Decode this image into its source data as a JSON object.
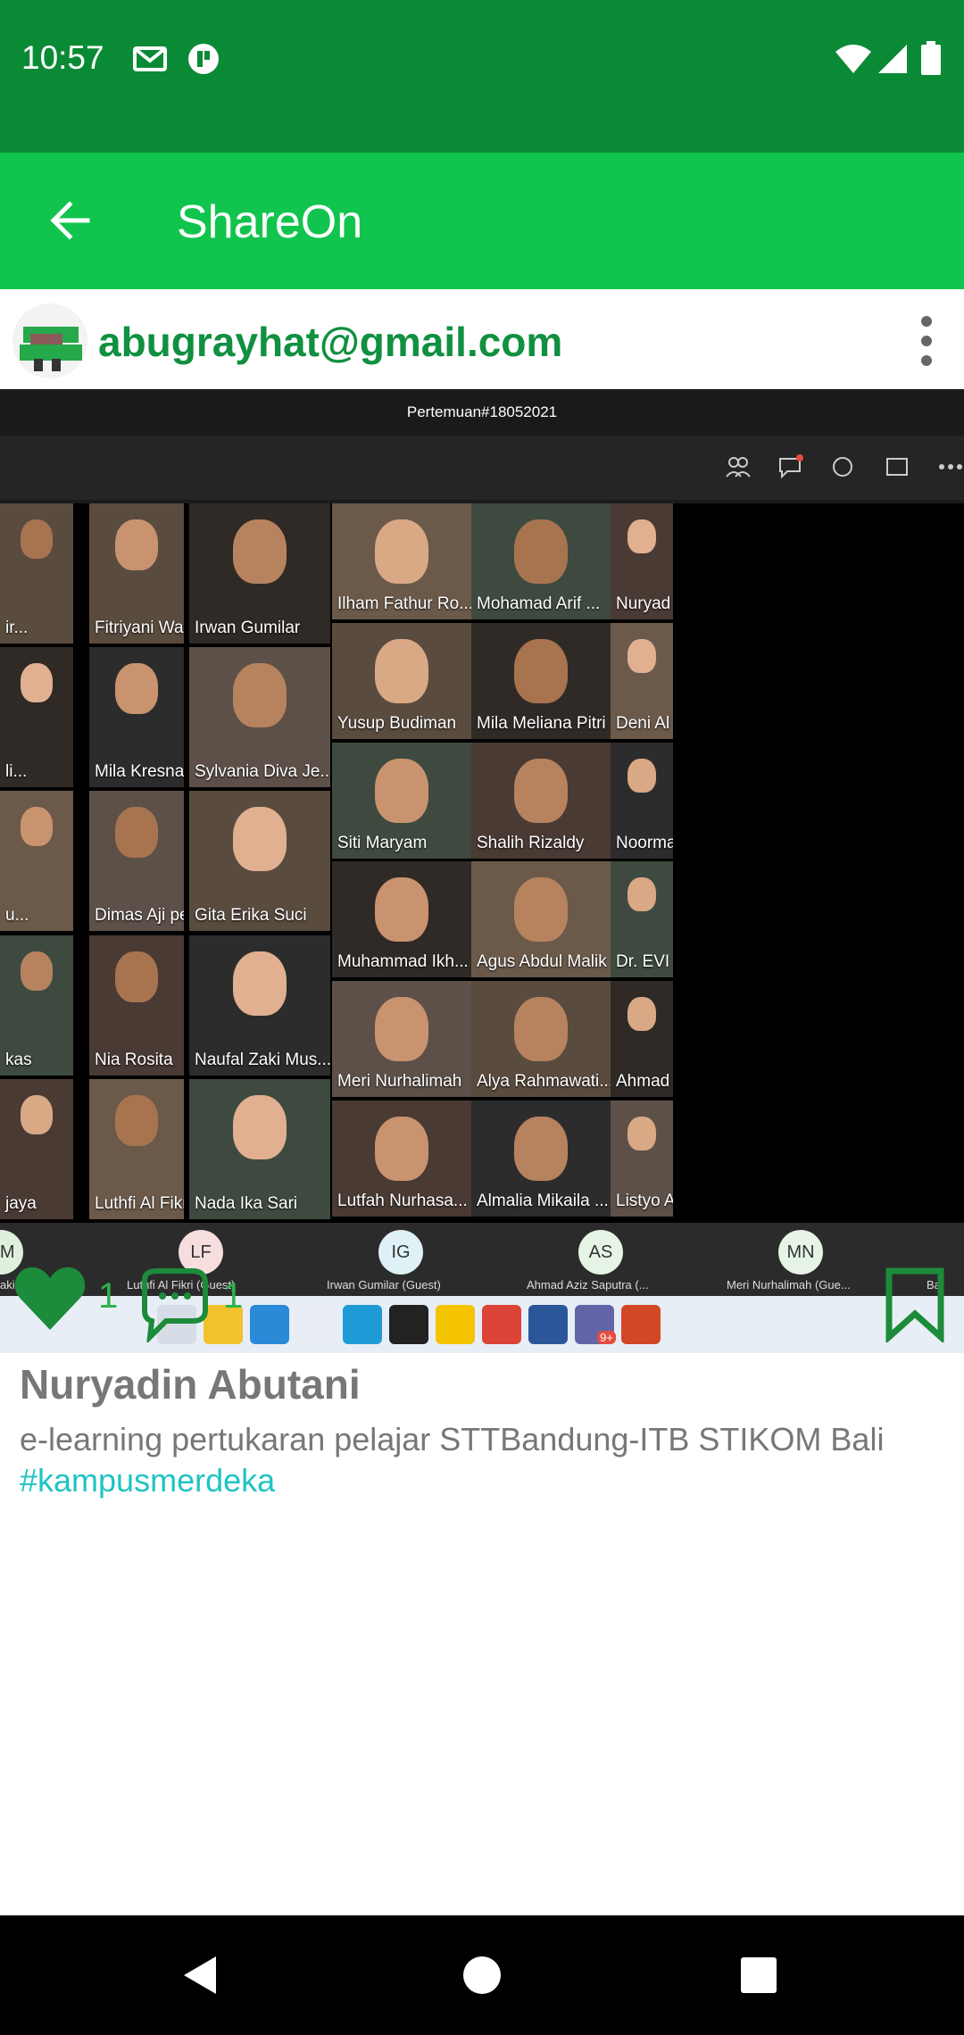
{
  "status": {
    "time": "10:57"
  },
  "appbar": {
    "title": "ShareOn"
  },
  "post": {
    "email": "abugrayhat@gmail.com",
    "author": "Nuryadin Abutani",
    "caption": "e-learning pertukaran pelajar STTBandung-ITB STIKOM Bali",
    "hashtag": "#kampusmerdeka",
    "like_count": "1",
    "comment_count": "1"
  },
  "meeting": {
    "title": "Pertemuan#18052021",
    "tiles": [
      {
        "name": "Fitriyani Wana L..."
      },
      {
        "name": "Irwan Gumilar"
      },
      {
        "name": "Ilham Fathur Ro..."
      },
      {
        "name": "Mohamad Arif ..."
      },
      {
        "name": "Nuryad"
      },
      {
        "name": "Mila Kresna Peb..."
      },
      {
        "name": "Sylvania Diva Je..."
      },
      {
        "name": "Yusup Budiman"
      },
      {
        "name": "Mila Meliana Pitri"
      },
      {
        "name": "Deni Al"
      },
      {
        "name": "Siti Maryam"
      },
      {
        "name": "Shalih Rizaldy"
      },
      {
        "name": "Noorma"
      },
      {
        "name": "Dimas Aji permadi"
      },
      {
        "name": "Gita Erika Suci"
      },
      {
        "name": "Muhammad Ikh..."
      },
      {
        "name": "Agus Abdul Malik"
      },
      {
        "name": "Dr. EVI"
      },
      {
        "name": "Nia Rosita"
      },
      {
        "name": "Naufal Zaki Mus..."
      },
      {
        "name": "Meri Nurhalimah"
      },
      {
        "name": "Alya Rahmawati..."
      },
      {
        "name": "Ahmad"
      },
      {
        "name": "Luthfi Al Fikri"
      },
      {
        "name": "Nada Ika Sari"
      },
      {
        "name": "Lutfah Nurhasa..."
      },
      {
        "name": "Almalia Mikaila ..."
      },
      {
        "name": "Listyo A"
      },
      {
        "name": "ir..."
      },
      {
        "name": "li..."
      },
      {
        "name": "u..."
      },
      {
        "name": "kas"
      },
      {
        "name": "jaya"
      }
    ],
    "participants": [
      {
        "initials": "NM",
        "name": "aki"
      },
      {
        "initials": "LF",
        "name": "Luthfi Al Fikri (Guest)"
      },
      {
        "initials": "IG",
        "name": "Irwan Gumilar (Guest)"
      },
      {
        "initials": "AS",
        "name": "Ahmad Aziz Saputra (..."
      },
      {
        "initials": "MN",
        "name": "Meri Nurhalimah (Gue..."
      },
      {
        "initials": "",
        "name": "Ba"
      }
    ],
    "taskbar_badge": "9+"
  },
  "colors": {
    "statusbar": "#0b8a36",
    "appbar": "#11c44d",
    "accent": "#109040",
    "hashtag": "#20c3c3"
  },
  "icons": {
    "back": "arrow-left-icon",
    "more": "more-vert-icon",
    "like": "heart-icon",
    "comment": "comment-icon",
    "bookmark": "bookmark-icon"
  }
}
